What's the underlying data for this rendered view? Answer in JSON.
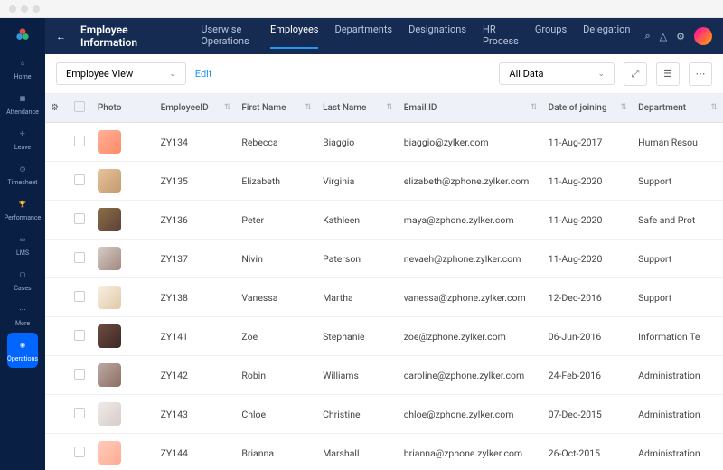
{
  "page_title": "Employee Information",
  "topbar_tabs": [
    "Userwise Operations",
    "Employees",
    "Departments",
    "Designations",
    "HR Process",
    "Groups",
    "Delegation"
  ],
  "active_tab": 1,
  "sidebar": [
    {
      "label": "Home",
      "icon": "home"
    },
    {
      "label": "Attendance",
      "icon": "cal"
    },
    {
      "label": "Leave",
      "icon": "leave"
    },
    {
      "label": "Timesheet",
      "icon": "clock"
    },
    {
      "label": "Performance",
      "icon": "trophy"
    },
    {
      "label": "LMS",
      "icon": "book"
    },
    {
      "label": "Cases",
      "icon": "case"
    },
    {
      "label": "More",
      "icon": "more"
    },
    {
      "label": "Operations",
      "icon": "ops",
      "active": true
    }
  ],
  "view_dropdown": "Employee View",
  "edit_link": "Edit",
  "filter_dropdown": "All Data",
  "columns": [
    "Photo",
    "EmployeeID",
    "First Name",
    "Last Name",
    "Email ID",
    "Date of joining",
    "Department"
  ],
  "rows": [
    {
      "id": "ZY134",
      "fn": "Rebecca",
      "ln": "Biaggio",
      "em": "biaggio@zylker.com",
      "dj": "11-Aug-2017",
      "dp": "Human Resou"
    },
    {
      "id": "ZY135",
      "fn": "Elizabeth",
      "ln": "Virginia",
      "em": "elizabeth@zphone.zylker.com",
      "dj": "11-Aug-2020",
      "dp": "Support"
    },
    {
      "id": "ZY136",
      "fn": "Peter",
      "ln": "Kathleen",
      "em": "maya@zphone.zylker.com",
      "dj": "11-Aug-2020",
      "dp": "Safe and Prot"
    },
    {
      "id": "ZY137",
      "fn": "Nivin",
      "ln": "Paterson",
      "em": "nevaeh@zphone.zylker.com",
      "dj": "11-Aug-2020",
      "dp": "Support"
    },
    {
      "id": "ZY138",
      "fn": "Vanessa",
      "ln": "Martha",
      "em": "vanessa@zphone.zylker.com",
      "dj": "12-Dec-2016",
      "dp": "Support"
    },
    {
      "id": "ZY141",
      "fn": "Zoe",
      "ln": "Stephanie",
      "em": "zoe@zphone.zylker.com",
      "dj": "06-Jun-2016",
      "dp": "Information Te"
    },
    {
      "id": "ZY142",
      "fn": "Robin",
      "ln": "Williams",
      "em": "caroline@zphone.zylker.com",
      "dj": "24-Feb-2016",
      "dp": "Administration"
    },
    {
      "id": "ZY143",
      "fn": "Chloe",
      "ln": "Christine",
      "em": "chloe@zphone.zylker.com",
      "dj": "07-Dec-2015",
      "dp": "Administration"
    },
    {
      "id": "ZY144",
      "fn": "Brianna",
      "ln": "Marshall",
      "em": "brianna@zphone.zylker.com",
      "dj": "26-Oct-2015",
      "dp": "Administration"
    }
  ]
}
